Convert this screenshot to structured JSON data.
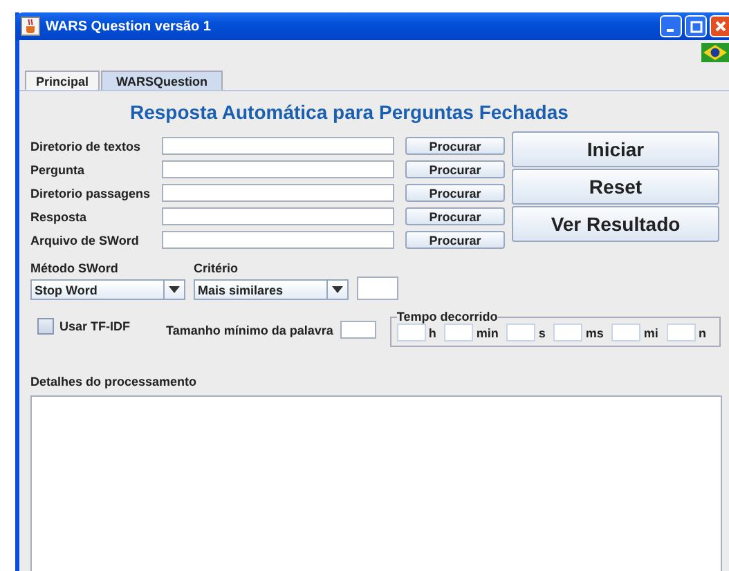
{
  "window": {
    "title": "WARS Question versão 1"
  },
  "tabs": [
    {
      "label": "Principal",
      "selected": false
    },
    {
      "label": "WARSQuestion",
      "selected": true
    }
  ],
  "heading": "Resposta Automática para Perguntas Fechadas",
  "fields": [
    {
      "label": "Diretorio de textos",
      "button": "Procurar"
    },
    {
      "label": "Pergunta",
      "button": "Procurar"
    },
    {
      "label": "Diretorio passagens",
      "button": "Procurar"
    },
    {
      "label": "Resposta",
      "button": "Procurar"
    },
    {
      "label": "Arquivo de SWord",
      "button": "Procurar"
    }
  ],
  "actions": [
    "Iniciar",
    "Reset",
    "Ver Resultado"
  ],
  "metodo": {
    "label": "Método SWord",
    "value": "Stop Word"
  },
  "criterio": {
    "label": "Critério",
    "value": "Mais similares"
  },
  "tfidf": {
    "label": "Usar TF-IDF",
    "checked": false
  },
  "tamanho": {
    "label": "Tamanho mínimo da palavra"
  },
  "tempo": {
    "title": "Tempo decorrido",
    "units": [
      "h",
      "min",
      "s",
      "ms",
      "mi",
      "n"
    ]
  },
  "detalhes": {
    "label": "Detalhes do processamento"
  }
}
